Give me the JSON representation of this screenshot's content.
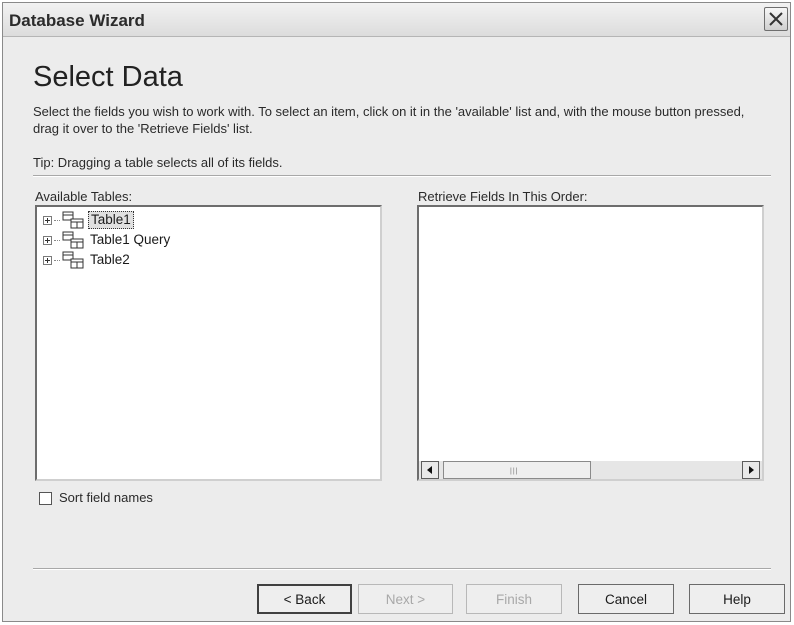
{
  "window": {
    "title": "Database Wizard"
  },
  "header": {
    "title": "Select Data",
    "description": "Select the fields you wish to work with. To select an item, click on it in the 'available' list and, with the mouse button pressed, drag it over to the 'Retrieve Fields' list.",
    "tip": "Tip: Dragging a table selects all of its fields."
  },
  "available": {
    "label": "Available Tables:",
    "items": [
      {
        "label": "Table1",
        "selected": true
      },
      {
        "label": "Table1 Query",
        "selected": false
      },
      {
        "label": "Table2",
        "selected": false
      }
    ]
  },
  "retrieve": {
    "label": "Retrieve Fields In This Order:",
    "items": []
  },
  "options": {
    "sort_label": "Sort field names",
    "sort_checked": false
  },
  "buttons": {
    "back": "< Back",
    "next": "Next >",
    "finish": "Finish",
    "cancel": "Cancel",
    "help": "Help"
  },
  "icons": {
    "close": "close-icon",
    "table": "table-icon",
    "expand": "plus-expander-icon",
    "scroll_left": "arrow-left-icon",
    "scroll_right": "arrow-right-icon"
  }
}
